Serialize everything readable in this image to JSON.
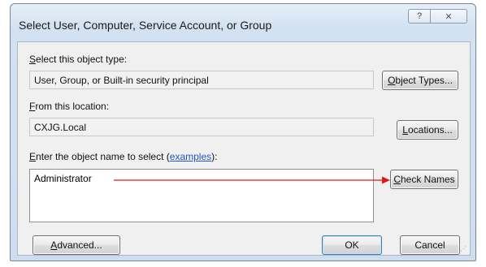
{
  "window": {
    "title": "Select User, Computer, Service Account, or Group",
    "help_icon": "?",
    "close_icon": "✕"
  },
  "object_type": {
    "label_accel": "S",
    "label_rest": "elect this object type:",
    "value": "User, Group, or Built-in security principal",
    "button_accel": "O",
    "button_rest": "bject Types..."
  },
  "location": {
    "label_accel": "F",
    "label_rest": "rom this location:",
    "value": "CXJG.Local",
    "button_accel": "L",
    "button_rest": "ocations..."
  },
  "object_name": {
    "label_accel": "E",
    "label_rest": "nter the object name to select (",
    "label_link": "examples",
    "label_end": "):",
    "value": "Administrator",
    "check_button_accel": "C",
    "check_button_rest": "heck Names"
  },
  "footer": {
    "advanced_accel": "A",
    "advanced_rest": "dvanced...",
    "ok_label": "OK",
    "cancel_label": "Cancel"
  },
  "annotation": {
    "arrow_color": "#e01818"
  }
}
